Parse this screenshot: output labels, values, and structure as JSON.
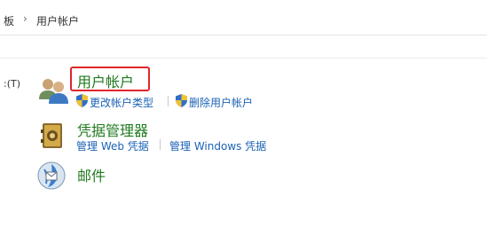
{
  "breadcrumb": {
    "prev_partial": "板",
    "separator": "›",
    "current": "用户帐户"
  },
  "menu": {
    "tools_partial": ":(T)"
  },
  "categories": [
    {
      "title": "用户帐户",
      "icon": "users-icon",
      "links": [
        "更改帐户类型",
        "删除用户帐户"
      ]
    },
    {
      "title": "凭据管理器",
      "icon": "credential-vault-icon",
      "links": [
        "管理 Web 凭据",
        "管理 Windows 凭据"
      ]
    },
    {
      "title": "邮件",
      "icon": "mail-icon",
      "links": []
    }
  ],
  "colors": {
    "category_title": "#1f7a1f",
    "link": "#1b62b5",
    "highlight": "#e0262d"
  }
}
